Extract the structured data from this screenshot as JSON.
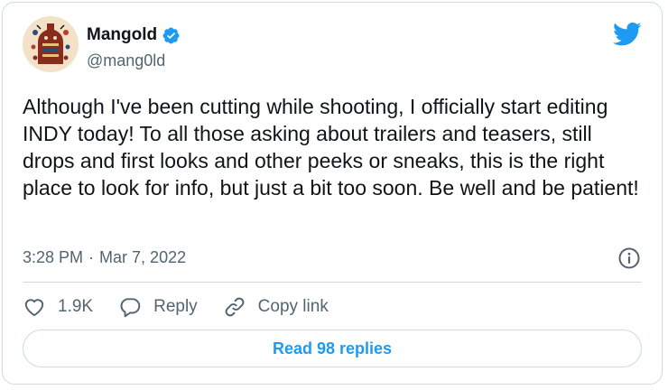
{
  "author": {
    "name": "Mangold",
    "handle": "@mang0ld",
    "verified": true
  },
  "tweet": {
    "text": "Although I've been cutting while shooting, I officially start editing INDY today! To all those asking about trailers and teasers, still drops and first looks and other peeks or sneaks, this is the right place to look for info, but just a bit too soon. Be well and be patient!",
    "time": "3:28 PM",
    "separator": "·",
    "date": "Mar 7, 2022"
  },
  "actions": {
    "like_count": "1.9K",
    "reply_label": "Reply",
    "copy_label": "Copy link"
  },
  "read_replies_label": "Read 98 replies",
  "colors": {
    "accent": "#1d9bf0",
    "text": "#0f1419",
    "secondary": "#536471",
    "border": "#cfd9de"
  },
  "icons": {
    "brand": "twitter-bird-icon",
    "verified": "verified-badge-icon",
    "info": "info-icon",
    "like": "heart-icon",
    "reply": "reply-bubble-icon",
    "copy": "link-icon"
  }
}
